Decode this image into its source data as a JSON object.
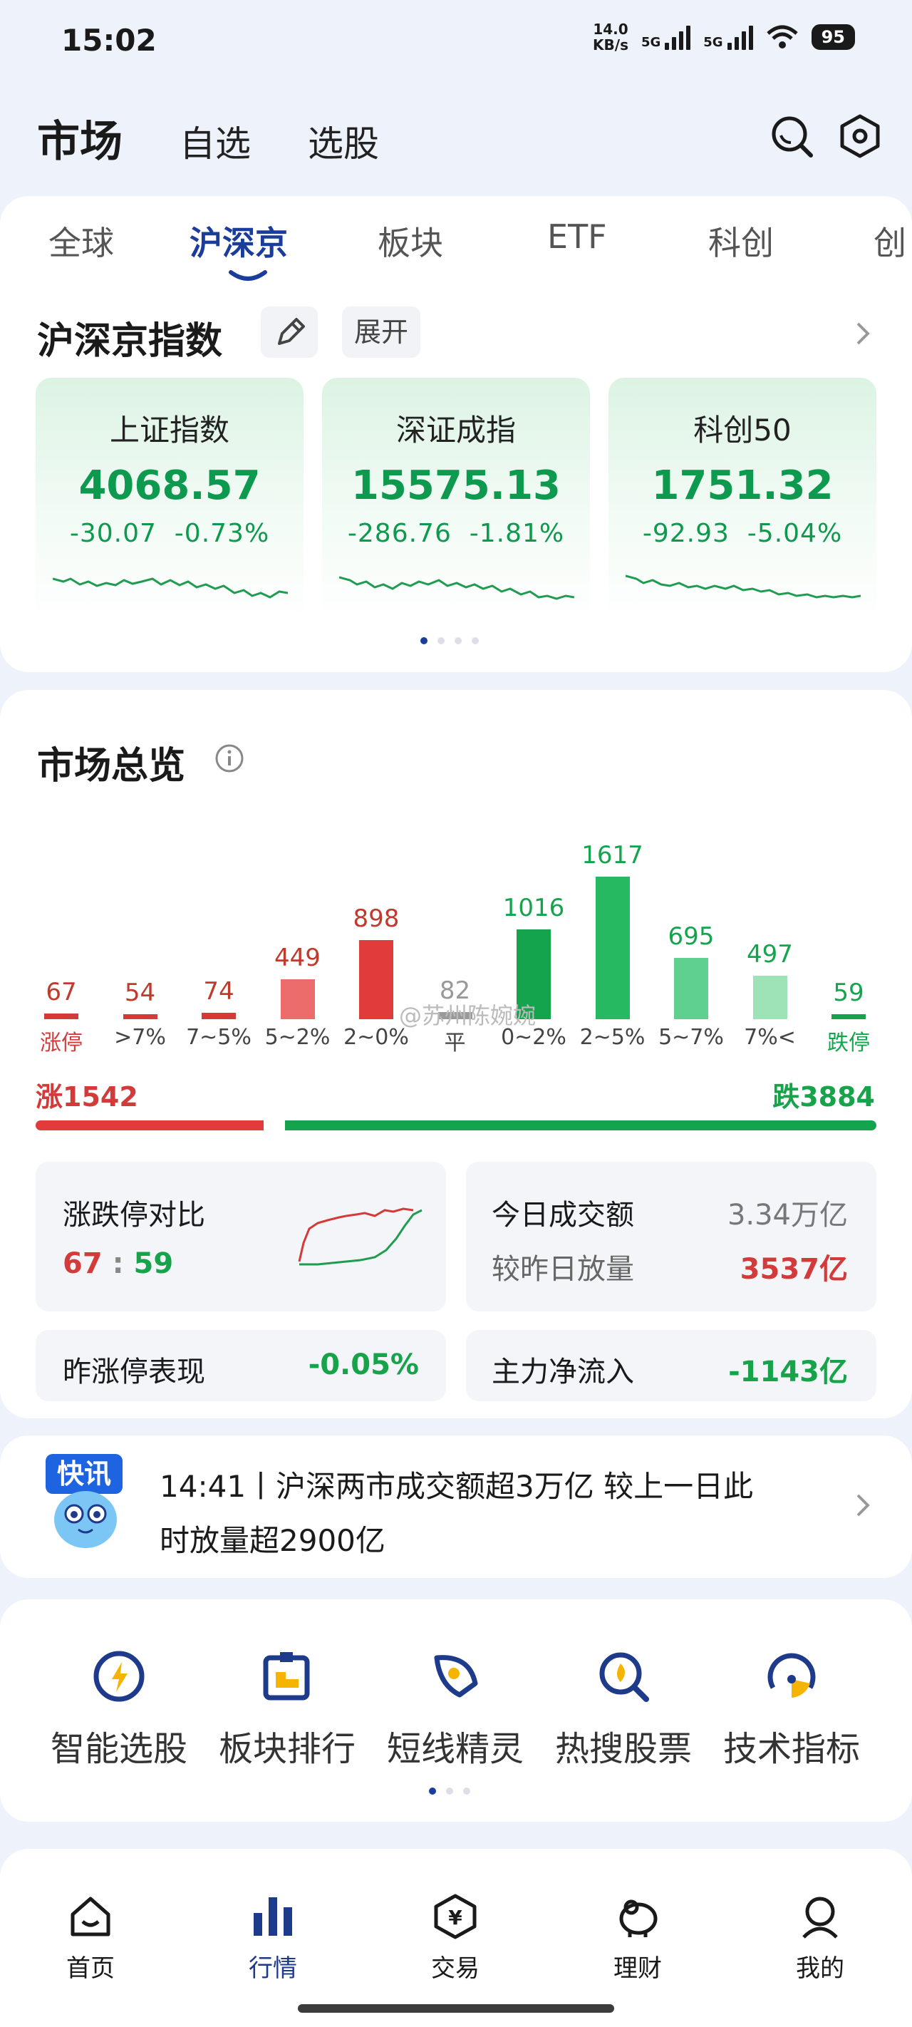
{
  "status_bar": {
    "time": "15:02",
    "net_speed_top": "14.0",
    "net_speed_bottom": "KB/s",
    "net1": "5G",
    "net2": "5G",
    "battery": "95"
  },
  "header": {
    "tab_market": "市场",
    "tab_watchlist": "自选",
    "tab_screener": "选股",
    "icons": [
      "search-icon",
      "settings-hex-icon"
    ]
  },
  "subtabs": [
    "全球",
    "沪深京",
    "板块",
    "ETF",
    "科创",
    "创"
  ],
  "indices_section": {
    "title": "沪深京指数",
    "expand": "展开",
    "cards": [
      {
        "name": "上证指数",
        "value": "4068.57",
        "change": "-30.07",
        "pct": "-0.73%"
      },
      {
        "name": "深证成指",
        "value": "15575.13",
        "change": "-286.76",
        "pct": "-1.81%"
      },
      {
        "name": "科创50",
        "value": "1751.32",
        "change": "-92.93",
        "pct": "-5.04%"
      }
    ]
  },
  "overview": {
    "title": "市场总览",
    "watermark": "@苏州陈婉婉",
    "distribution": [
      {
        "label": "涨停",
        "count": 67,
        "color": "#d33a3a"
      },
      {
        "label": ">7%",
        "count": 54,
        "color": "#d33a3a"
      },
      {
        "label": "7~5%",
        "count": 74,
        "color": "#d33a3a"
      },
      {
        "label": "5~2%",
        "count": 449,
        "color": "#ec6b6b"
      },
      {
        "label": "2~0%",
        "count": 898,
        "color": "#e23b3b"
      },
      {
        "label": "平",
        "count": 82,
        "color": "#999999"
      },
      {
        "label": "0~2%",
        "count": 1016,
        "color": "#14a44d"
      },
      {
        "label": "2~5%",
        "count": 1617,
        "color": "#26b961"
      },
      {
        "label": "5~7%",
        "count": 695,
        "color": "#5fd08d"
      },
      {
        "label": "7%<",
        "count": 497,
        "color": "#9ee2b7"
      },
      {
        "label": "跌停",
        "count": 59,
        "color": "#14a44d"
      }
    ],
    "up_label": "涨1542",
    "down_label": "跌3884",
    "up_ratio": 0.284,
    "limit_compare": {
      "title": "涨跌停对比",
      "up": "67",
      "sep": ":",
      "down": "59"
    },
    "turnover": {
      "label": "今日成交额",
      "value": "3.34万亿",
      "vs_label": "较昨日放量",
      "vs_value": "3537亿"
    },
    "yesterday_limit": {
      "label": "昨涨停表现",
      "value": "-0.05%"
    },
    "main_inflow": {
      "label": "主力净流入",
      "value": "-1143亿"
    }
  },
  "news": {
    "badge": "快讯",
    "text_line1": "14:41丨沪深两市成交额超3万亿 较上一日此",
    "text_line2": "时放量超2900亿"
  },
  "quick_tools": [
    {
      "label": "智能选股",
      "icon": "lightning-icon"
    },
    {
      "label": "板块排行",
      "icon": "puzzle-icon"
    },
    {
      "label": "短线精灵",
      "icon": "rocket-icon"
    },
    {
      "label": "热搜股票",
      "icon": "magnify-icon"
    },
    {
      "label": "技术指标",
      "icon": "gauge-icon"
    }
  ],
  "bottom_nav": [
    {
      "label": "首页",
      "icon": "home-icon"
    },
    {
      "label": "行情",
      "icon": "bar-chart-icon",
      "active": true
    },
    {
      "label": "交易",
      "icon": "yen-icon"
    },
    {
      "label": "理财",
      "icon": "piggy-bank-icon"
    },
    {
      "label": "我的",
      "icon": "user-icon"
    }
  ]
}
